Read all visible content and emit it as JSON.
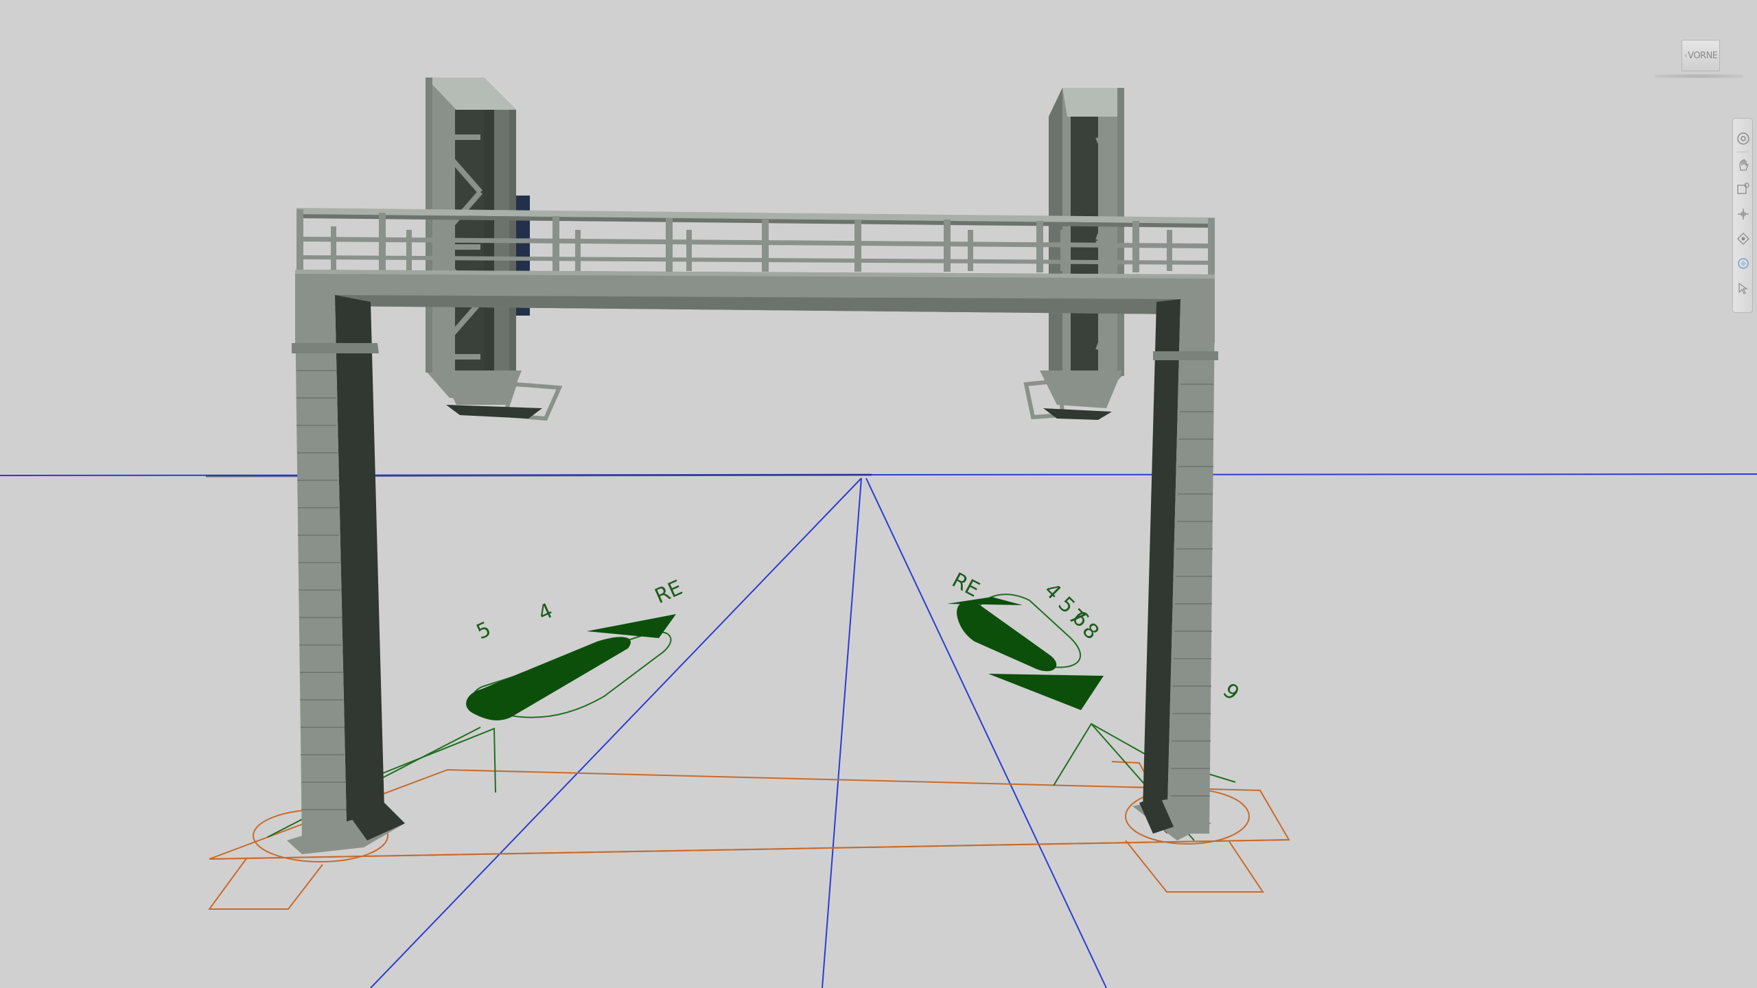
{
  "viewcube": {
    "face_label": "VORNE"
  },
  "scene": {
    "annotations": {
      "left_symbol_label_1": "5",
      "left_symbol_label_2": "4",
      "left_symbol_label_3": "RE",
      "right_symbol_label_1": "RE",
      "right_symbol_label_2": "4 5 6",
      "right_symbol_label_3": "7 8",
      "right_symbol_label_4": "9"
    },
    "colors": {
      "background": "#d0d0d0",
      "structure_light": "#8a918a",
      "structure_dark": "#313731",
      "signal_symbol": "#0b4f0b",
      "annotation_line": "#1f6e1f",
      "axis_line": "#2a3cd0",
      "footprint_line": "#c86a2a"
    }
  },
  "navbar": {
    "tools": [
      {
        "icon": "full-navigation-wheel-icon"
      },
      {
        "icon": "pan-icon"
      },
      {
        "icon": "zoom-window-icon"
      },
      {
        "icon": "orbit-icon"
      },
      {
        "icon": "look-icon"
      },
      {
        "icon": "walk-icon"
      },
      {
        "icon": "select-icon"
      }
    ]
  }
}
